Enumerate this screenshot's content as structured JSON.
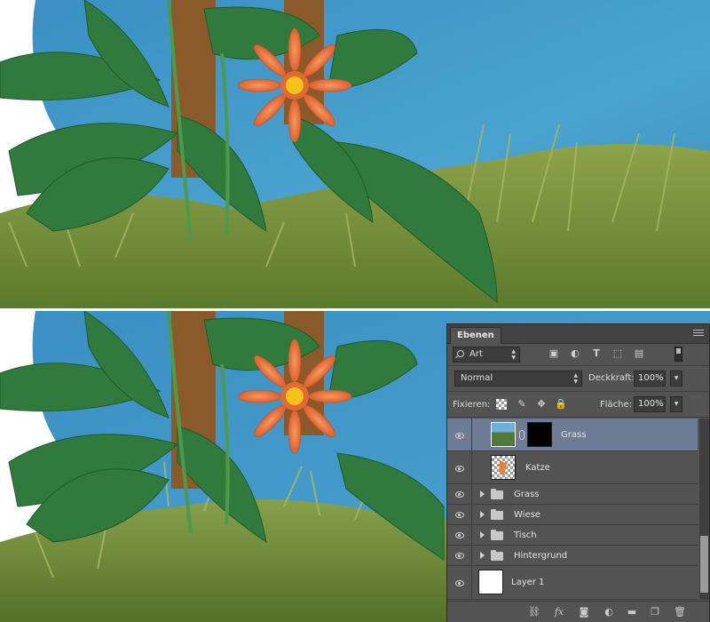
{
  "colors": {
    "sky": "#4a9ac4",
    "grass": "#6f8a35",
    "leaf": "#2f7a3c",
    "flower": "#e8703d",
    "panel_bg": "#535353",
    "selected_row": "#6e7b94"
  },
  "layers_panel": {
    "tab_title": "Ebenen",
    "filter": {
      "value": "Art",
      "icons": [
        "image-filter-icon",
        "adjustment-filter-icon",
        "type-filter-icon",
        "shape-filter-icon",
        "smart-object-filter-icon"
      ]
    },
    "blend_mode": "Normal",
    "opacity_label": "Deckkraft:",
    "opacity_value": "100%",
    "lock_label": "Fixieren:",
    "fill_label": "Fläche:",
    "fill_value": "100%",
    "layers": [
      {
        "name": "Grass",
        "kind": "layer-with-mask",
        "selected": true,
        "visible": true
      },
      {
        "name": "Katze",
        "kind": "layer",
        "selected": false,
        "visible": true
      },
      {
        "name": "Grass",
        "kind": "group",
        "selected": false,
        "visible": true
      },
      {
        "name": "Wiese",
        "kind": "group",
        "selected": false,
        "visible": true
      },
      {
        "name": "Tisch",
        "kind": "group",
        "selected": false,
        "visible": true
      },
      {
        "name": "Hintergrund",
        "kind": "group",
        "selected": false,
        "visible": true
      },
      {
        "name": "Layer 1",
        "kind": "layer",
        "selected": false,
        "visible": true
      }
    ],
    "bottom_icons": [
      "link-layers-icon",
      "fx-icon",
      "add-mask-icon",
      "adjustment-layer-icon",
      "new-group-icon",
      "new-layer-icon",
      "trash-icon"
    ],
    "fx_label": "fx"
  }
}
